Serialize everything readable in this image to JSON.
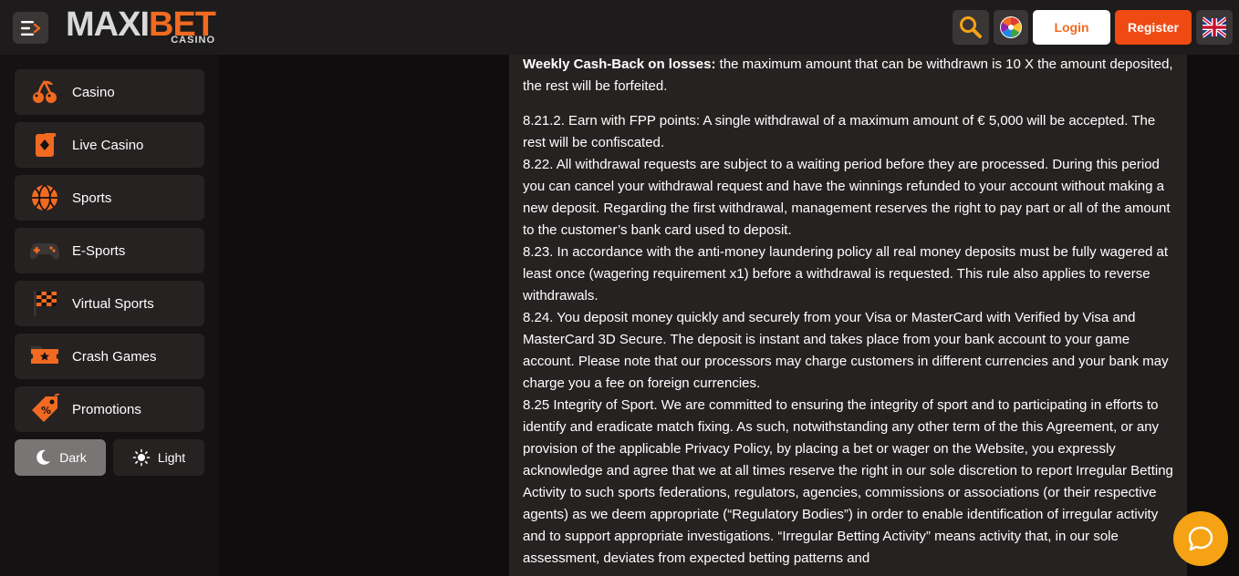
{
  "header": {
    "logo_main": "MAXI",
    "logo_accent": "BET",
    "logo_sub": "CASINO",
    "login_label": "Login",
    "register_label": "Register",
    "colors": {
      "accent": "#f26a21",
      "register_bg": "#f04a13",
      "header_bg": "#1d1b1b"
    }
  },
  "sidebar": {
    "items": [
      {
        "label": "Casino",
        "icon": "cherries-icon"
      },
      {
        "label": "Live Casino",
        "icon": "playing-card-icon"
      },
      {
        "label": "Sports",
        "icon": "basketball-icon"
      },
      {
        "label": "E-Sports",
        "icon": "gamepad-icon"
      },
      {
        "label": "Virtual Sports",
        "icon": "checkered-flag-icon"
      },
      {
        "label": "Crash Games",
        "icon": "ticket-icon"
      },
      {
        "label": "Promotions",
        "icon": "price-tag-icon"
      }
    ],
    "theme": {
      "dark_label": "Dark",
      "light_label": "Light"
    }
  },
  "content": {
    "lead_bold": "Weekly Cash-Back on losses:",
    "lead_text": " the maximum amount that can be withdrawn is 10 X the amount deposited, the rest will be forfeited.",
    "paragraphs": [
      "8.21.2. Earn with FPP points: A single withdrawal of a maximum amount of € 5,000 will be accepted. The rest will be confiscated.",
      "8.22. All withdrawal requests are subject to a waiting period before they are processed. During this period you can cancel your withdrawal request and have the winnings refunded to your account without making a new deposit. Regarding the first withdrawal, management reserves the right to pay part or all of the amount to the customer’s bank card used to deposit.",
      "8.23. In accordance with the anti-money laundering policy all real money deposits must be fully wagered at least once (wagering requirement x1) before a withdrawal is requested. This rule also applies to reverse withdrawals.",
      "8.24. You deposit money quickly and securely from your Visa or MasterCard with Verified by Visa and MasterCard 3D Secure. The deposit is instant and takes place from your bank account to your game account. Please note that our processors may charge customers in different currencies and your bank may charge you a fee on foreign currencies.",
      "8.25 Integrity of Sport. We are committed to ensuring the integrity of sport and to participating in efforts to identify and eradicate match fixing. As such, notwithstanding any other term of the this Agreement, or any provision of the applicable Privacy Policy, by placing a bet or wager on the Website, you expressly acknowledge and agree that we at all times reserve the right in our sole discretion to report Irregular Betting Activity to such sports federations, regulators, agencies, commissions or associations (or their respective agents) as we deem appropriate (“Regulatory Bodies”) in order to enable identification of irregular activity and to support appropriate investigations. “Irregular Betting Activity” means activity that, in our sole assessment, deviates from expected betting patterns and"
    ]
  }
}
